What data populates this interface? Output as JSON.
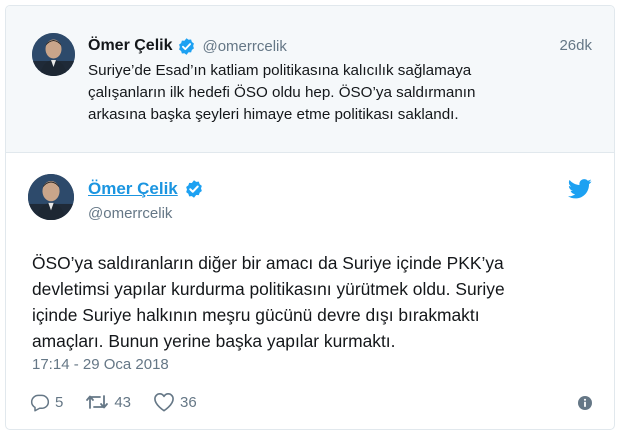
{
  "parent_tweet": {
    "author_name": "Ömer Çelik",
    "author_handle": "@omerrcelik",
    "timestamp": "26dk",
    "text_lines": [
      "Suriye’de Esad’ın katliam politikasına kalıcılık sağlamaya",
      "çalışanların ilk hedefi ÖSO oldu hep. ÖSO’ya saldırmanın",
      "arkasına başka şeyleri himaye etme politikası saklandı."
    ]
  },
  "main_tweet": {
    "author_name": "Ömer Çelik",
    "author_handle": "@omerrcelik",
    "text_lines": [
      "ÖSO’ya saldıranların diğer bir amacı da Suriye içinde PKK’ya",
      "devletimsi yapılar kurdurma politikasını yürütmek oldu. Suriye",
      "içinde Suriye halkının meşru gücünü devre dışı bırakmaktı",
      "amaçları. Bunun yerine başka yapılar kurmaktı."
    ],
    "datetime": "17:14 - 29 Oca 2018",
    "stats": {
      "replies": "5",
      "retweets": "43",
      "likes": "36"
    }
  },
  "icons": {
    "verified": "verified-badge-icon",
    "brand": "twitter-bird-icon",
    "reply": "reply-icon",
    "retweet": "retweet-icon",
    "like": "heart-icon",
    "info": "info-icon"
  },
  "colors": {
    "link_blue": "#1b95e0",
    "verified_blue": "#1da1f2",
    "muted_gray": "#657786",
    "parent_bg": "#f5f8fa"
  }
}
